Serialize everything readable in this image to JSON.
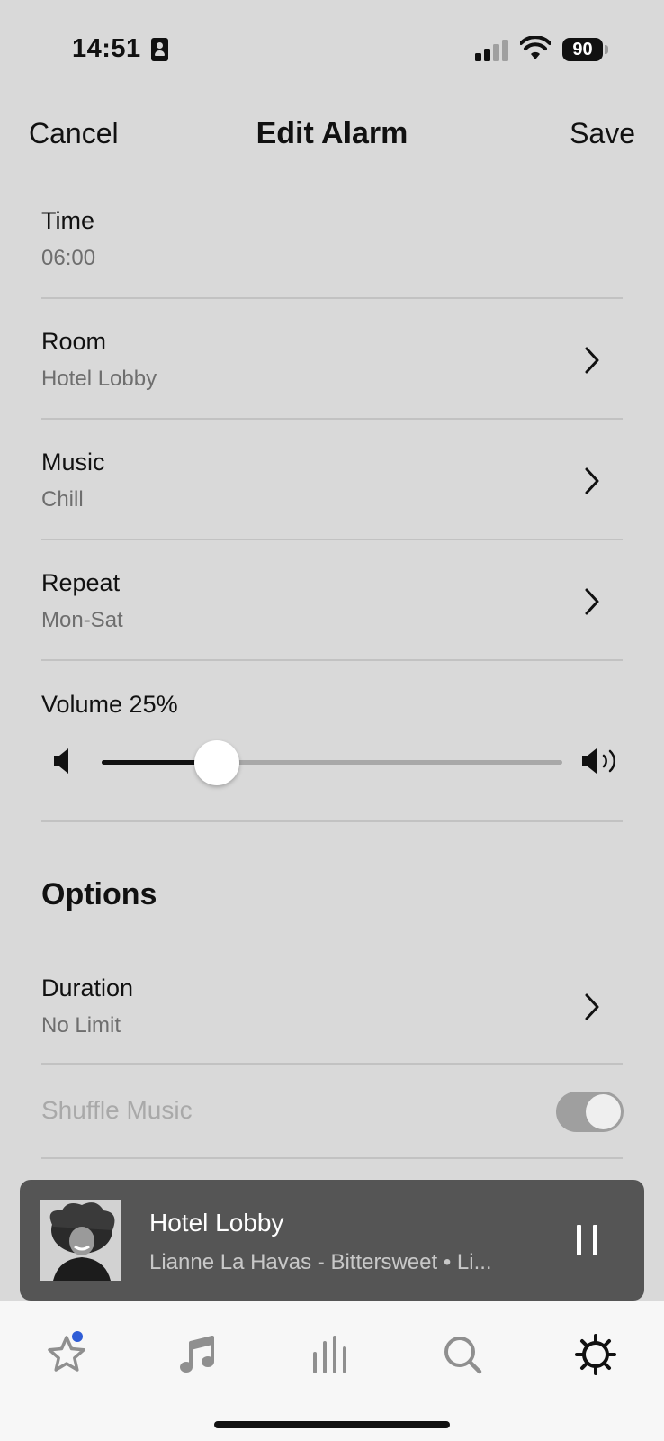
{
  "status_bar": {
    "time": "14:51",
    "battery": "90"
  },
  "nav": {
    "cancel_label": "Cancel",
    "title": "Edit Alarm",
    "save_label": "Save"
  },
  "settings": {
    "time": {
      "label": "Time",
      "value": "06:00"
    },
    "room": {
      "label": "Room",
      "value": "Hotel Lobby"
    },
    "music": {
      "label": "Music",
      "value": "Chill"
    },
    "repeat": {
      "label": "Repeat",
      "value": "Mon-Sat"
    },
    "volume": {
      "label": "Volume 25%",
      "level_percent": 25
    }
  },
  "options": {
    "heading": "Options",
    "duration": {
      "label": "Duration",
      "value": "No Limit"
    },
    "shuffle": {
      "label": "Shuffle Music",
      "enabled": false,
      "on": true
    }
  },
  "now_playing": {
    "title": "Hotel Lobby",
    "subtitle": "Lianne La Havas - Bittersweet • Li..."
  },
  "tabs": [
    {
      "icon": "star-icon",
      "has_badge": true,
      "badge_color": "#2f5dd6"
    },
    {
      "icon": "music-note-icon"
    },
    {
      "icon": "bars-icon"
    },
    {
      "icon": "search-icon"
    },
    {
      "icon": "gear-icon",
      "active": true
    }
  ],
  "colors": {
    "background": "#d9d9d9",
    "tab_bar": "#f7f7f7",
    "now_playing_bg": "#555555",
    "badge": "#2f5dd6"
  }
}
